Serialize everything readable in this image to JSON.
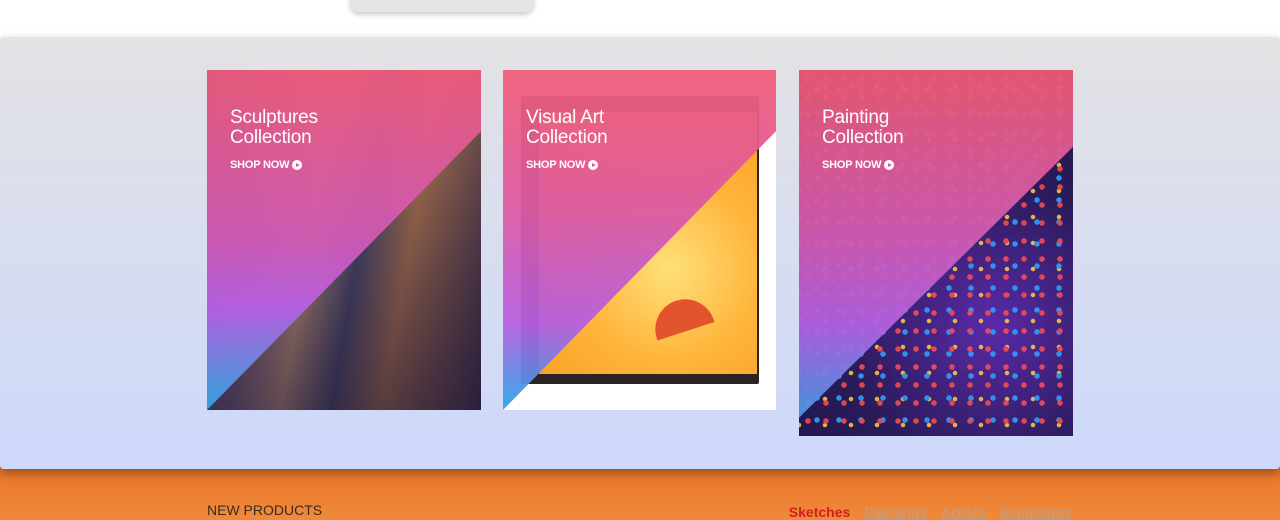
{
  "cards": [
    {
      "title_line1": "Sculptures",
      "title_line2": "Collection",
      "cta": "SHOP NOW"
    },
    {
      "title_line1": "Visual Art",
      "title_line2": "Collection",
      "cta": "SHOP NOW"
    },
    {
      "title_line1": "Painting",
      "title_line2": "Collection",
      "cta": "SHOP NOW"
    }
  ],
  "section": {
    "title": "NEW PRODUCTS",
    "filters": [
      "Sketches",
      "Paintings",
      "Artists",
      "Sculptures"
    ],
    "active_filter": "Sketches"
  },
  "colors": {
    "overlay_top": "#ec5a7a",
    "overlay_mid": "#b760e5",
    "overlay_bottom": "#30a8e0",
    "accent_orange": "#e8681f",
    "active_filter": "#d41f1f"
  }
}
